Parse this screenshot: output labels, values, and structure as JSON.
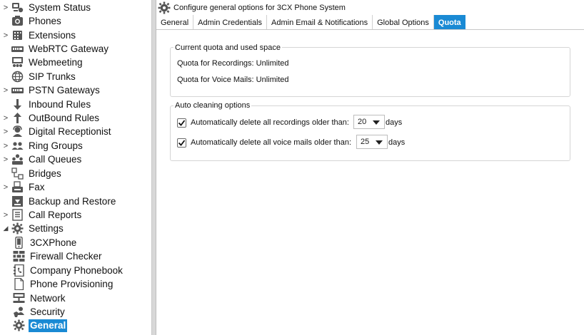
{
  "sidebar": {
    "items": [
      {
        "label": "System Status",
        "icon": "system-status-icon",
        "expandable": true
      },
      {
        "label": "Phones",
        "icon": "phone-icon",
        "expandable": false
      },
      {
        "label": "Extensions",
        "icon": "extensions-icon",
        "expandable": true
      },
      {
        "label": "WebRTC Gateway",
        "icon": "webrtc-gateway-icon",
        "expandable": false
      },
      {
        "label": "Webmeeting",
        "icon": "webmeeting-icon",
        "expandable": false
      },
      {
        "label": "SIP Trunks",
        "icon": "globe-icon",
        "expandable": false
      },
      {
        "label": "PSTN Gateways",
        "icon": "pstn-gateway-icon",
        "expandable": true
      },
      {
        "label": "Inbound Rules",
        "icon": "arrow-down-icon",
        "expandable": false
      },
      {
        "label": "OutBound Rules",
        "icon": "arrow-up-icon",
        "expandable": true
      },
      {
        "label": "Digital Receptionist",
        "icon": "receptionist-icon",
        "expandable": true
      },
      {
        "label": "Ring Groups",
        "icon": "ring-groups-icon",
        "expandable": true
      },
      {
        "label": "Call Queues",
        "icon": "call-queues-icon",
        "expandable": true
      },
      {
        "label": "Bridges",
        "icon": "bridges-icon",
        "expandable": false
      },
      {
        "label": "Fax",
        "icon": "fax-icon",
        "expandable": true
      },
      {
        "label": "Backup and Restore",
        "icon": "backup-icon",
        "expandable": false
      },
      {
        "label": "Call Reports",
        "icon": "call-reports-icon",
        "expandable": true
      },
      {
        "label": "Settings",
        "icon": "gear-icon",
        "expandable": true,
        "expanded": true
      }
    ],
    "settings_children": [
      {
        "label": "3CXPhone",
        "icon": "mobile-phone-icon"
      },
      {
        "label": "Firewall Checker",
        "icon": "firewall-icon"
      },
      {
        "label": "Company Phonebook",
        "icon": "phonebook-icon"
      },
      {
        "label": "Phone Provisioning",
        "icon": "document-icon"
      },
      {
        "label": "Network",
        "icon": "network-icon"
      },
      {
        "label": "Security",
        "icon": "security-icon"
      },
      {
        "label": "General",
        "icon": "gear-icon",
        "selected": true
      }
    ]
  },
  "header": {
    "title": "Configure general options for 3CX Phone System"
  },
  "tabs": [
    {
      "label": "General",
      "active": false
    },
    {
      "label": "Admin Credentials",
      "active": false
    },
    {
      "label": "Admin Email & Notifications",
      "active": false
    },
    {
      "label": "Global Options",
      "active": false
    },
    {
      "label": "Quota",
      "active": true
    }
  ],
  "quota_group": {
    "legend": "Current quota and used space",
    "recordings": "Quota for Recordings: Unlimited",
    "voicemails": "Quota for Voice Mails: Unlimited"
  },
  "auto_clean_group": {
    "legend": "Auto cleaning options",
    "recordings_label": "Automatically delete all recordings older than:",
    "recordings_checked": true,
    "recordings_days": "20",
    "voicemails_label": "Automatically delete all voice mails older than:",
    "voicemails_checked": true,
    "voicemails_days": "25",
    "unit": "days"
  },
  "colors": {
    "accent": "#1a8ad4",
    "icon": "#555555"
  }
}
